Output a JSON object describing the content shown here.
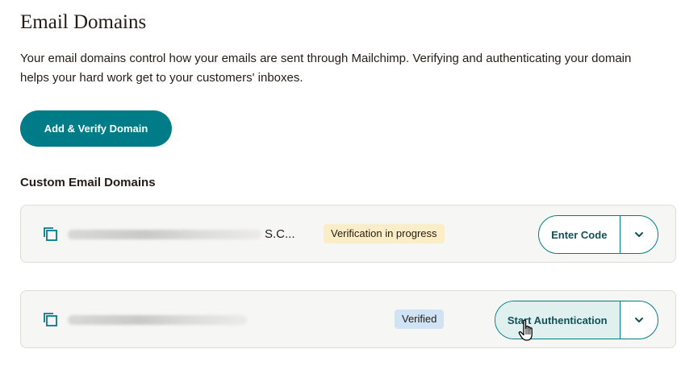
{
  "page": {
    "title": "Email Domains",
    "description": "Your email domains control how your emails are sent through Mailchimp. Verifying and authenticating your domain helps your hard work get to your customers' inboxes.",
    "add_button_label": "Add & Verify Domain",
    "section_heading": "Custom Email Domains"
  },
  "domains": [
    {
      "name_visible_suffix": "s.c...",
      "status": "Verification in progress",
      "status_color": "#fbeec7",
      "action_label": "Enter Code",
      "icons": [
        "copy-icon",
        "chevron-down-icon"
      ]
    },
    {
      "name_visible_suffix": "",
      "status": "Verified",
      "status_color": "#cfe3f4",
      "action_label": "Start Authentication",
      "icons": [
        "copy-icon",
        "chevron-down-icon"
      ]
    }
  ],
  "colors": {
    "accent": "#007c89",
    "text": "#241c15",
    "row_background": "#f6f6f4"
  },
  "cursor": "hand-pointer"
}
